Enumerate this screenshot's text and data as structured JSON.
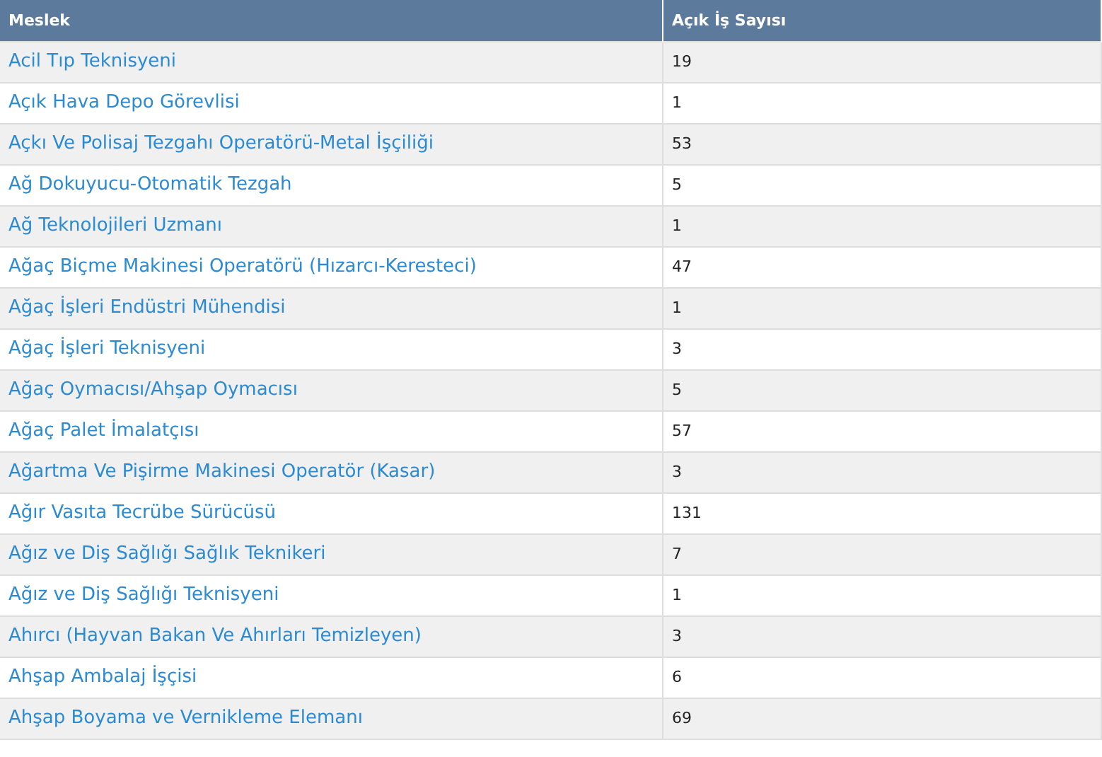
{
  "table": {
    "columns": [
      "Meslek",
      "Açık İş Sayısı"
    ],
    "rows": [
      {
        "meslek": "Acil Tıp Teknisyeni",
        "count": "19"
      },
      {
        "meslek": "Açık Hava Depo Görevlisi",
        "count": "1"
      },
      {
        "meslek": "Açkı Ve Polisaj Tezgahı Operatörü-Metal İşçiliği",
        "count": "53"
      },
      {
        "meslek": "Ağ Dokuyucu-Otomatik Tezgah",
        "count": "5"
      },
      {
        "meslek": "Ağ Teknolojileri Uzmanı",
        "count": "1"
      },
      {
        "meslek": "Ağaç Biçme Makinesi Operatörü (Hızarcı-Keresteci)",
        "count": "47"
      },
      {
        "meslek": "Ağaç İşleri Endüstri Mühendisi",
        "count": "1"
      },
      {
        "meslek": "Ağaç İşleri Teknisyeni",
        "count": "3"
      },
      {
        "meslek": "Ağaç Oymacısı/Ahşap Oymacısı",
        "count": "5"
      },
      {
        "meslek": "Ağaç Palet İmalatçısı",
        "count": "57"
      },
      {
        "meslek": "Ağartma Ve Pişirme Makinesi Operatör (Kasar)",
        "count": "3"
      },
      {
        "meslek": "Ağır Vasıta Tecrübe Sürücüsü",
        "count": "131"
      },
      {
        "meslek": "Ağız ve Diş Sağlığı Sağlık Teknikeri",
        "count": "7"
      },
      {
        "meslek": "Ağız ve Diş Sağlığı Teknisyeni",
        "count": "1"
      },
      {
        "meslek": "Ahırcı (Hayvan Bakan Ve Ahırları Temizleyen)",
        "count": "3"
      },
      {
        "meslek": "Ahşap Ambalaj İşçisi",
        "count": "6"
      },
      {
        "meslek": "Ahşap Boyama ve Vernikleme Elemanı",
        "count": "69"
      }
    ]
  }
}
